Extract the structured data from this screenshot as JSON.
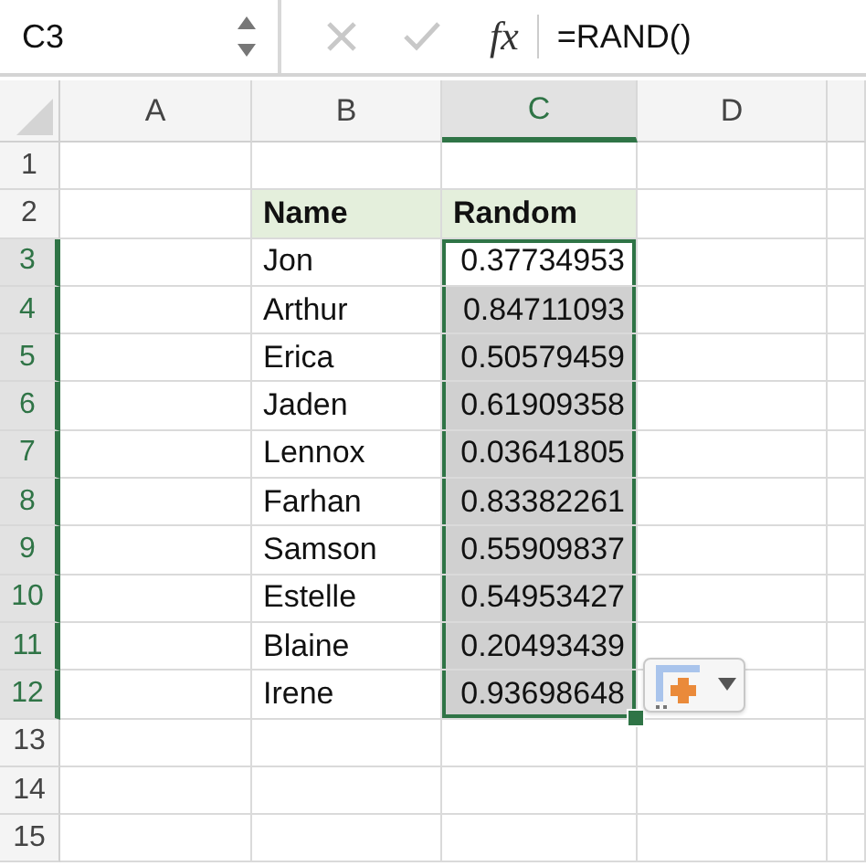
{
  "name_box": "C3",
  "function_label": "fx",
  "formula": "=RAND()",
  "columns": [
    {
      "label": "A",
      "selected": false
    },
    {
      "label": "B",
      "selected": false
    },
    {
      "label": "C",
      "selected": true
    },
    {
      "label": "D",
      "selected": false
    }
  ],
  "rows": [
    {
      "number": "1",
      "selected": false,
      "kind": "blank"
    },
    {
      "number": "2",
      "selected": false,
      "kind": "header",
      "name": "Name",
      "value": "Random"
    },
    {
      "number": "3",
      "selected": true,
      "kind": "data",
      "name": "Jon",
      "value": "0.37734953",
      "active": true
    },
    {
      "number": "4",
      "selected": true,
      "kind": "data",
      "name": "Arthur",
      "value": "0.84711093",
      "active": false
    },
    {
      "number": "5",
      "selected": true,
      "kind": "data",
      "name": "Erica",
      "value": "0.50579459",
      "active": false
    },
    {
      "number": "6",
      "selected": true,
      "kind": "data",
      "name": "Jaden",
      "value": "0.61909358",
      "active": false
    },
    {
      "number": "7",
      "selected": true,
      "kind": "data",
      "name": "Lennox",
      "value": "0.03641805",
      "active": false
    },
    {
      "number": "8",
      "selected": true,
      "kind": "data",
      "name": "Farhan",
      "value": "0.83382261",
      "active": false
    },
    {
      "number": "9",
      "selected": true,
      "kind": "data",
      "name": "Samson",
      "value": "0.55909837",
      "active": false
    },
    {
      "number": "10",
      "selected": true,
      "kind": "data",
      "name": "Estelle",
      "value": "0.54953427",
      "active": false
    },
    {
      "number": "11",
      "selected": true,
      "kind": "data",
      "name": "Blaine",
      "value": "0.20493439",
      "active": false
    },
    {
      "number": "12",
      "selected": true,
      "kind": "data",
      "name": "Irene",
      "value": "0.93698648",
      "active": false
    },
    {
      "number": "13",
      "selected": false,
      "kind": "blank"
    },
    {
      "number": "14",
      "selected": false,
      "kind": "blank"
    },
    {
      "number": "15",
      "selected": false,
      "kind": "blank"
    }
  ]
}
